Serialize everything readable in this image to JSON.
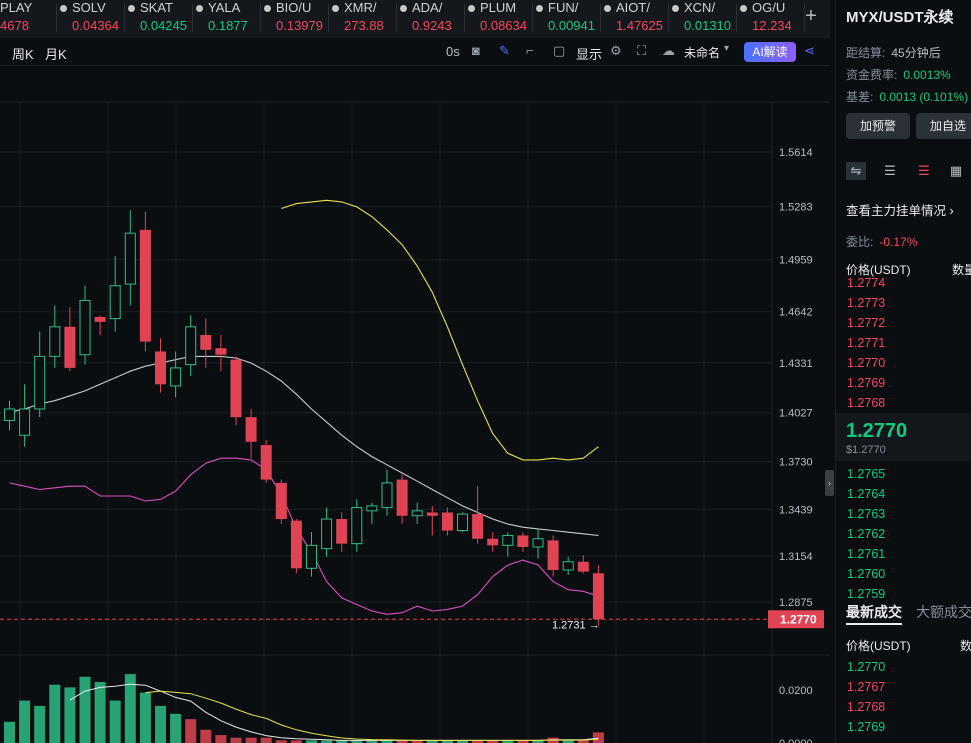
{
  "ticker": [
    {
      "sym": "PLAY",
      "price": "4678",
      "color": "#f6465d"
    },
    {
      "sym": "SOLV",
      "price": "0.04364",
      "color": "#f6465d"
    },
    {
      "sym": "SKAT",
      "price": "0.04245",
      "color": "#0ecb81"
    },
    {
      "sym": "YALA",
      "price": "0.1877",
      "color": "#0ecb81"
    },
    {
      "sym": "BIO/U",
      "price": "0.13979",
      "color": "#f6465d"
    },
    {
      "sym": "XMR/",
      "price": "273.88",
      "color": "#f6465d"
    },
    {
      "sym": "ADA/",
      "price": "0.9243",
      "color": "#f6465d"
    },
    {
      "sym": "PLUM",
      "price": "0.08634",
      "color": "#f6465d"
    },
    {
      "sym": "FUN/",
      "price": "0.00941",
      "color": "#0ecb81"
    },
    {
      "sym": "AIOT/",
      "price": "1.47625",
      "color": "#f6465d"
    },
    {
      "sym": "XCN/",
      "price": "0.01310",
      "color": "#0ecb81"
    },
    {
      "sym": "OG/U",
      "price": "12.234",
      "color": "#f6465d"
    }
  ],
  "toolbar": {
    "week": "周K",
    "month": "月K",
    "zero_s": "0s",
    "display": "显示",
    "unnamed": "未命名",
    "ai_label": "AI解读",
    "plus": "+"
  },
  "chart_data": {
    "type": "candlestick",
    "y_ticks": [
      "1.5614",
      "1.5283",
      "1.4959",
      "1.4642",
      "1.4331",
      "1.4027",
      "1.3730",
      "1.3439",
      "1.3154",
      "1.2875"
    ],
    "current_price_label": "1.2770",
    "last_low_label": "1.2731 →",
    "volume_ticks": [
      "0.0200",
      "0.0000"
    ],
    "candles": [
      {
        "o": 1.398,
        "h": 1.41,
        "l": 1.392,
        "c": 1.405
      },
      {
        "o": 1.389,
        "h": 1.42,
        "l": 1.382,
        "c": 1.405
      },
      {
        "o": 1.405,
        "h": 1.452,
        "l": 1.4,
        "c": 1.437
      },
      {
        "o": 1.437,
        "h": 1.468,
        "l": 1.43,
        "c": 1.455
      },
      {
        "o": 1.455,
        "h": 1.467,
        "l": 1.428,
        "c": 1.43
      },
      {
        "o": 1.438,
        "h": 1.48,
        "l": 1.432,
        "c": 1.471
      },
      {
        "o": 1.461,
        "h": 1.462,
        "l": 1.45,
        "c": 1.458
      },
      {
        "o": 1.46,
        "h": 1.498,
        "l": 1.452,
        "c": 1.48
      },
      {
        "o": 1.481,
        "h": 1.526,
        "l": 1.468,
        "c": 1.512
      },
      {
        "o": 1.514,
        "h": 1.525,
        "l": 1.44,
        "c": 1.446
      },
      {
        "o": 1.44,
        "h": 1.448,
        "l": 1.415,
        "c": 1.42
      },
      {
        "o": 1.419,
        "h": 1.44,
        "l": 1.412,
        "c": 1.43
      },
      {
        "o": 1.432,
        "h": 1.462,
        "l": 1.425,
        "c": 1.455
      },
      {
        "o": 1.45,
        "h": 1.46,
        "l": 1.43,
        "c": 1.441
      },
      {
        "o": 1.442,
        "h": 1.45,
        "l": 1.428,
        "c": 1.438
      },
      {
        "o": 1.435,
        "h": 1.437,
        "l": 1.395,
        "c": 1.4
      },
      {
        "o": 1.4,
        "h": 1.405,
        "l": 1.375,
        "c": 1.385
      },
      {
        "o": 1.383,
        "h": 1.386,
        "l": 1.36,
        "c": 1.362
      },
      {
        "o": 1.36,
        "h": 1.362,
        "l": 1.335,
        "c": 1.338
      },
      {
        "o": 1.337,
        "h": 1.338,
        "l": 1.305,
        "c": 1.308
      },
      {
        "o": 1.308,
        "h": 1.33,
        "l": 1.303,
        "c": 1.322
      },
      {
        "o": 1.32,
        "h": 1.345,
        "l": 1.315,
        "c": 1.338
      },
      {
        "o": 1.338,
        "h": 1.342,
        "l": 1.318,
        "c": 1.323
      },
      {
        "o": 1.323,
        "h": 1.35,
        "l": 1.318,
        "c": 1.345
      },
      {
        "o": 1.343,
        "h": 1.348,
        "l": 1.335,
        "c": 1.346
      },
      {
        "o": 1.345,
        "h": 1.368,
        "l": 1.34,
        "c": 1.36
      },
      {
        "o": 1.362,
        "h": 1.365,
        "l": 1.335,
        "c": 1.34
      },
      {
        "o": 1.34,
        "h": 1.348,
        "l": 1.335,
        "c": 1.343
      },
      {
        "o": 1.342,
        "h": 1.346,
        "l": 1.328,
        "c": 1.34
      },
      {
        "o": 1.342,
        "h": 1.345,
        "l": 1.328,
        "c": 1.331
      },
      {
        "o": 1.331,
        "h": 1.342,
        "l": 1.33,
        "c": 1.341
      },
      {
        "o": 1.341,
        "h": 1.358,
        "l": 1.323,
        "c": 1.326
      },
      {
        "o": 1.326,
        "h": 1.33,
        "l": 1.318,
        "c": 1.322
      },
      {
        "o": 1.322,
        "h": 1.33,
        "l": 1.315,
        "c": 1.328
      },
      {
        "o": 1.328,
        "h": 1.33,
        "l": 1.318,
        "c": 1.321
      },
      {
        "o": 1.321,
        "h": 1.332,
        "l": 1.314,
        "c": 1.326
      },
      {
        "o": 1.325,
        "h": 1.328,
        "l": 1.303,
        "c": 1.307
      },
      {
        "o": 1.307,
        "h": 1.315,
        "l": 1.304,
        "c": 1.312
      },
      {
        "o": 1.312,
        "h": 1.316,
        "l": 1.305,
        "c": 1.306
      },
      {
        "o": 1.305,
        "h": 1.31,
        "l": 1.273,
        "c": 1.277
      }
    ],
    "volumes": [
      0.008,
      0.016,
      0.014,
      0.022,
      0.021,
      0.025,
      0.023,
      0.016,
      0.026,
      0.019,
      0.014,
      0.011,
      0.009,
      0.005,
      0.003,
      0.002,
      0.002,
      0.002,
      0.001,
      0.001,
      0.001,
      0.001,
      0.001,
      0.001,
      0.001,
      0.001,
      0.001,
      0.001,
      0.001,
      0.001,
      0.001,
      0.001,
      0.001,
      0.001,
      0.001,
      0.001,
      0.002,
      0.001,
      0.001,
      0.004
    ],
    "volume_colors": [
      "g",
      "g",
      "g",
      "g",
      "g",
      "g",
      "g",
      "g",
      "g",
      "g",
      "g",
      "g",
      "r",
      "r",
      "r",
      "r",
      "r",
      "r",
      "r",
      "r",
      "g",
      "g",
      "g",
      "g",
      "g",
      "g",
      "r",
      "r",
      "g",
      "g",
      "g",
      "r",
      "r",
      "g",
      "r",
      "g",
      "r",
      "g",
      "r",
      "r"
    ],
    "upper_band": [
      null,
      null,
      null,
      null,
      null,
      null,
      null,
      null,
      null,
      null,
      null,
      null,
      null,
      null,
      null,
      null,
      null,
      null,
      1.527,
      1.53,
      1.531,
      1.532,
      1.531,
      1.528,
      1.522,
      1.514,
      1.505,
      1.492,
      1.476,
      1.455,
      1.432,
      1.41,
      1.39,
      1.378,
      1.374,
      1.374,
      1.375,
      1.374,
      1.375,
      1.382
    ],
    "middle_band": [
      1.403,
      1.405,
      1.408,
      1.41,
      1.413,
      1.416,
      1.42,
      1.424,
      1.428,
      1.431,
      1.433,
      1.435,
      1.437,
      1.437,
      1.437,
      1.436,
      1.433,
      1.428,
      1.422,
      1.414,
      1.405,
      1.397,
      1.389,
      1.382,
      1.376,
      1.371,
      1.366,
      1.361,
      1.356,
      1.351,
      1.346,
      1.342,
      1.338,
      1.335,
      1.333,
      1.332,
      1.331,
      1.33,
      1.329,
      1.328
    ],
    "lower_band": [
      1.36,
      1.358,
      1.356,
      1.357,
      1.358,
      1.358,
      1.352,
      1.352,
      1.352,
      1.349,
      1.35,
      1.355,
      1.365,
      1.372,
      1.375,
      1.375,
      1.374,
      1.368,
      1.353,
      1.332,
      1.318,
      1.3,
      1.29,
      1.286,
      1.282,
      1.28,
      1.281,
      1.285,
      1.282,
      1.283,
      1.285,
      1.292,
      1.303,
      1.31,
      1.313,
      1.31,
      1.3,
      1.295,
      1.294,
      1.291
    ]
  },
  "panel": {
    "title": "MYX/USDT永续",
    "settle_label": "距结算:",
    "settle_value": "45分钟后",
    "funding_label": "资金费率:",
    "funding_value": "0.0013%",
    "basis_label": "基差:",
    "basis_value": "0.0013 (0.101%)",
    "alert_btn": "加预警",
    "fav_btn": "加自选",
    "main_orders": "查看主力挂单情况",
    "ratio_label": "委比:",
    "ratio_value": "-0.17%",
    "price_header": "价格(USDT)",
    "qty_header": "数量",
    "asks": [
      "1.2774",
      "1.2773",
      "1.2772",
      "1.2771",
      "1.2770",
      "1.2769",
      "1.2768"
    ],
    "mid_price": "1.2770",
    "mid_sub": "$1.2770",
    "bids": [
      "1.2765",
      "1.2764",
      "1.2763",
      "1.2762",
      "1.2761",
      "1.2760",
      "1.2759"
    ],
    "tab_latest": "最新成交",
    "tab_big": "大额成交",
    "trade_price_header": "价格(USDT)",
    "trade_qty_header": "数",
    "trades": [
      {
        "p": "1.2770",
        "c": "green"
      },
      {
        "p": "1.2767",
        "c": "red"
      },
      {
        "p": "1.2768",
        "c": "red"
      },
      {
        "p": "1.2769",
        "c": "green"
      }
    ]
  }
}
